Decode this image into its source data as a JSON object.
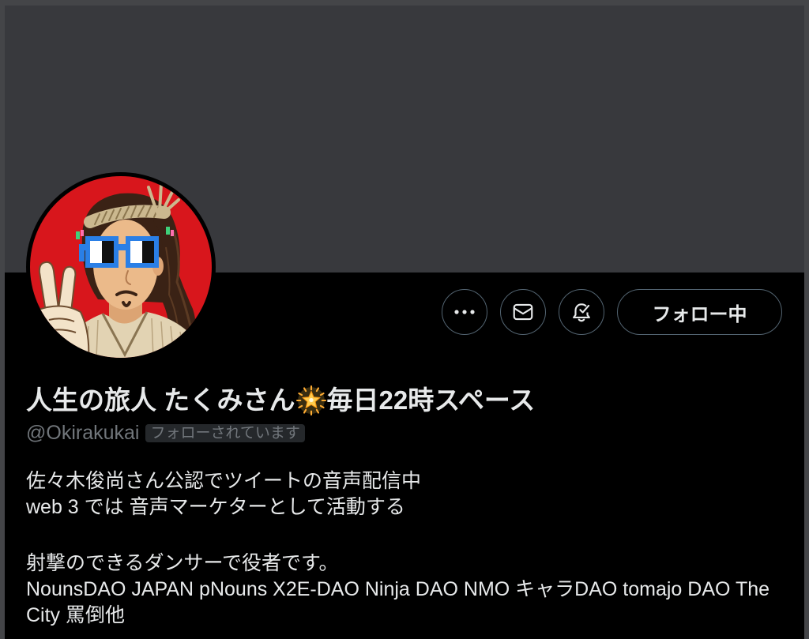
{
  "profile": {
    "name": {
      "before_emoji": "人生の旅人 たくみさん",
      "emoji_icon": "glowing-star-icon",
      "after_emoji": "毎日22時スペース"
    },
    "handle": "@Okirakukai",
    "follows_you_label": "フォローされています",
    "bio": [
      [
        "佐々木俊尚さん公認でツイートの音声配信中",
        "web 3 では 音声マーケターとして活動する"
      ],
      [
        "射撃のできるダンサーで役者です。",
        "NounsDAO JAPAN pNouns X2E-DAO Ninja DAO NMO キャラDAO tomajo DAO The City 罵倒他"
      ]
    ]
  },
  "actions": {
    "more_icon": "more-horizontal-icon",
    "message_icon": "envelope-icon",
    "notifications_icon": "bell-check-icon",
    "follow_button_label": "フォロー中"
  },
  "colors": {
    "page_background": "#000000",
    "banner": "#38393d",
    "text_primary": "#e7e9ea",
    "text_secondary": "#71767b",
    "button_border": "#536471",
    "badge_background": "#25282b",
    "avatar_background": "#d8161c",
    "glasses": "#2a7fe6"
  }
}
